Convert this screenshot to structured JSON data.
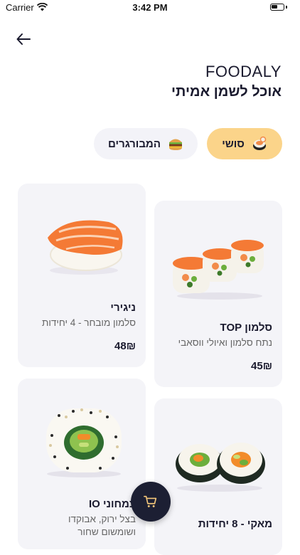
{
  "status_bar": {
    "carrier": "Carrier",
    "time": "3:42 PM"
  },
  "brand": {
    "name": "FOODALY",
    "tagline": "אוכל לשמן אמיתי"
  },
  "tabs": [
    {
      "label": "סושי",
      "icon": "sushi-emoji-icon",
      "active": true
    },
    {
      "label": "המבורגרים",
      "icon": "burger-emoji-icon",
      "active": false
    }
  ],
  "products": [
    {
      "title": "ניגירי",
      "desc": "סלמון מובחר - 4 יחידות",
      "price": "48₪",
      "image": "nigiri-image"
    },
    {
      "title": "סלמון TOP",
      "desc": "נתח סלמון ואיולי ווסאבי",
      "price": "45₪",
      "image": "salmon-roll-image"
    },
    {
      "title": "צמחוני IO",
      "desc": "בצל ירוק, אבוקדו",
      "desc2": "ושומשום שחור",
      "image": "vegetarian-roll-image"
    },
    {
      "title": "מאקי - 8 יחידות",
      "image": "maki-image"
    }
  ],
  "colors": {
    "accent": "#fbd48a",
    "card_bg": "#f4f4f8",
    "dark": "#1c1f33"
  }
}
